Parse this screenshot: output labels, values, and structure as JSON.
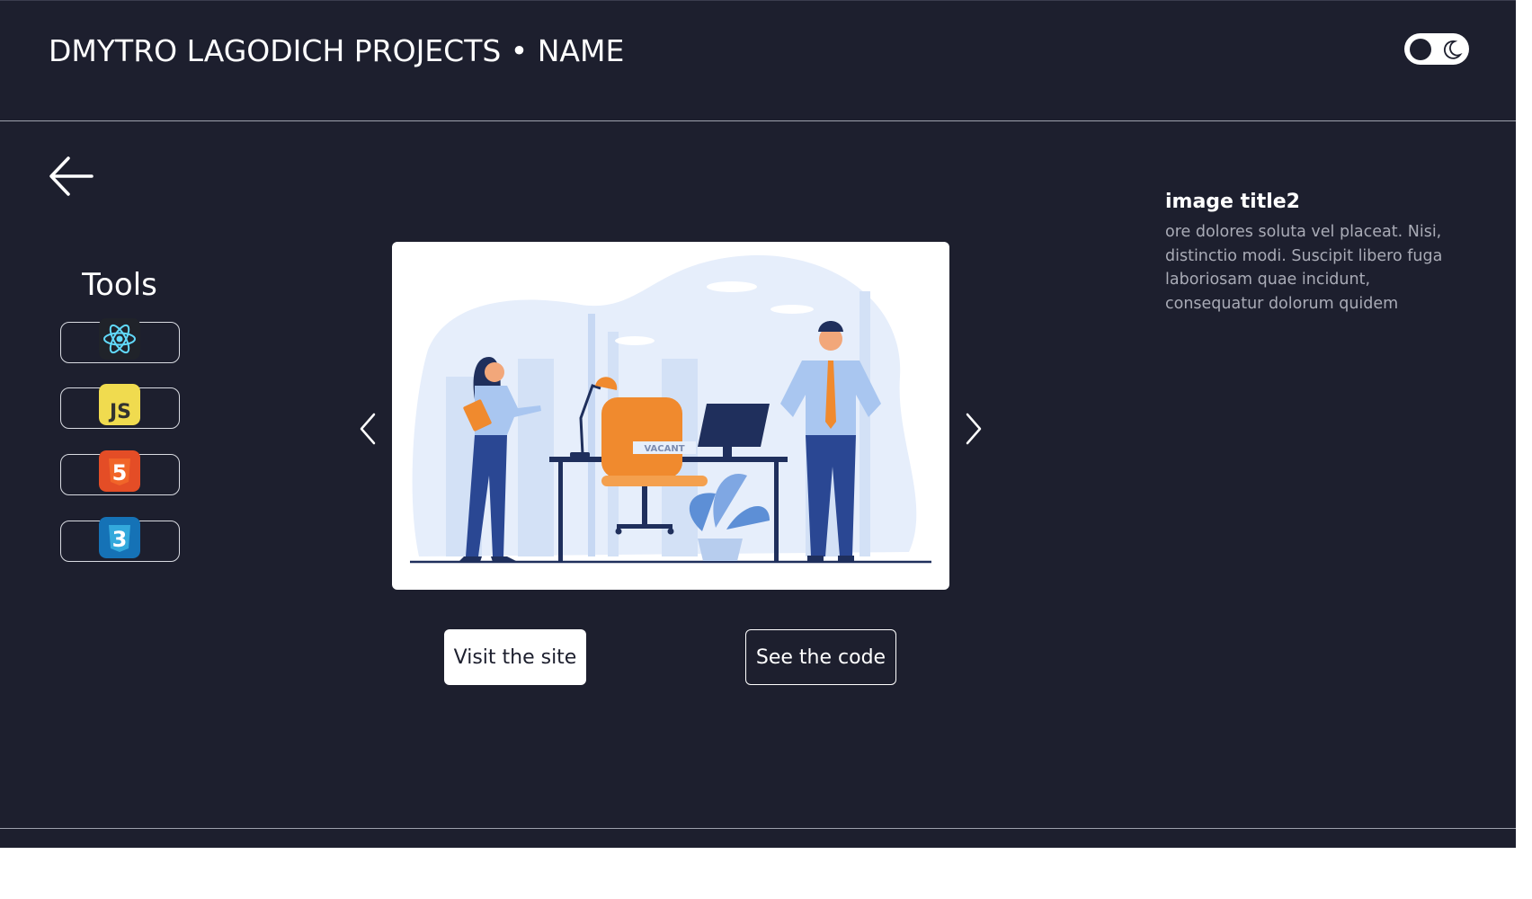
{
  "header": {
    "title": "DMYTRO LAGODICH PROJECTS • NAME",
    "theme_toggle_icon": "moon-icon"
  },
  "navigation": {
    "back_icon": "arrow-left-icon"
  },
  "tools": {
    "title": "Tools",
    "items": [
      {
        "name": "React",
        "icon": "react-icon",
        "color": "#61dafb"
      },
      {
        "name": "JavaScript",
        "icon": "js-icon",
        "label": "JS",
        "color": "#f0db4f"
      },
      {
        "name": "HTML5",
        "icon": "html5-icon",
        "label": "5",
        "color": "#e44d26"
      },
      {
        "name": "CSS3",
        "icon": "css3-icon",
        "label": "3",
        "color": "#1572b6"
      }
    ]
  },
  "carousel": {
    "prev_icon": "chevron-left-icon",
    "next_icon": "chevron-right-icon",
    "slide": {
      "sign_text": "VACANT"
    }
  },
  "actions": {
    "visit_label": "Visit the site",
    "code_label": "See the code"
  },
  "info": {
    "title": "image title2",
    "text": "ore dolores soluta vel placeat. Nisi, distinctio modi. Suscipit libero fuga laboriosam quae incidunt, consequatur dolorum quidem"
  },
  "colors": {
    "background": "#1d1f2e",
    "text": "#ffffff",
    "muted_text": "#a9abb6",
    "accent_orange": "#f08a2e",
    "accent_blue": "#2a4793"
  }
}
